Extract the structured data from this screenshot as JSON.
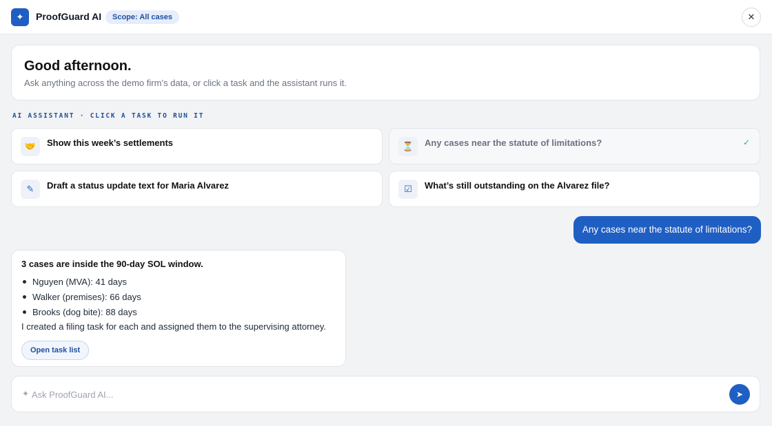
{
  "header": {
    "logo_glyph": "✦",
    "title": "ProofGuard AI",
    "scope_badge": "Scope: All cases",
    "close_glyph": "✕"
  },
  "greeting": {
    "title": "Good afternoon.",
    "subtitle": "Ask anything across the demo firm’s data, or click a task and the assistant runs it."
  },
  "section_label": "AI ASSISTANT · CLICK A TASK TO RUN IT",
  "tasks": [
    {
      "icon": "handshake-icon",
      "glyph": "🤝",
      "label": "Show this week’s settlements",
      "done": false
    },
    {
      "icon": "hourglass-icon",
      "glyph": "⏳",
      "label": "Any cases near the statute of limitations?",
      "done": true,
      "check": "✓"
    },
    {
      "icon": "pencil-icon",
      "glyph": "✎",
      "label": "Draft a status update text for Maria Alvarez",
      "done": false
    },
    {
      "icon": "checkbox-icon",
      "glyph": "☑",
      "label": "What’s still outstanding on the Alvarez file?",
      "done": false
    }
  ],
  "conversation": {
    "user_message": "Any cases near the statute of limitations?",
    "reply": {
      "heading": "3 cases are inside the 90-day SOL window.",
      "items": [
        "Nguyen (MVA): 41 days",
        "Walker (premises): 66 days",
        "Brooks (dog bite): 88 days"
      ],
      "note": "I created a filing task for each and assigned them to the supervising attorney.",
      "button_label": "Open task list"
    }
  },
  "input": {
    "spark_glyph": "✦",
    "placeholder": "Ask ProofGuard AI...",
    "value": "",
    "send_glyph": "➤"
  },
  "colors": {
    "accent": "#1f5fc4",
    "background": "#f2f3f5",
    "check": "#3aa88a"
  }
}
